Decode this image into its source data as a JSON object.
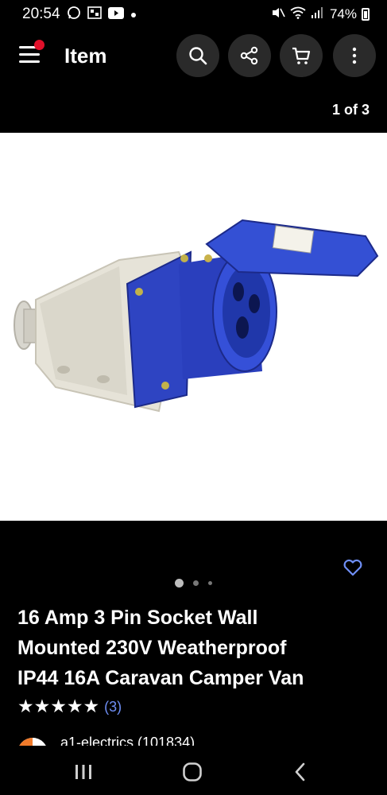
{
  "status_bar": {
    "time": "20:54",
    "battery": "74%"
  },
  "app_bar": {
    "title": "Item"
  },
  "gallery": {
    "counter": "1 of 3"
  },
  "product": {
    "title_lines": [
      "16 Amp 3 Pin Socket Wall",
      "Mounted 230V Weatherproof",
      "IP44 16A Caravan Camper Van"
    ],
    "stars": "★★★★★",
    "rating_stars": 5,
    "review_count": "(3)"
  },
  "seller": {
    "name": "a1-electrics (101834)"
  },
  "colors": {
    "accent_link": "#6f8ff6",
    "notification_dot": "#e0102a",
    "socket_blue": "#2f47c8"
  },
  "icons": {
    "menu": "hamburger-icon",
    "search": "search-icon",
    "share": "share-icon",
    "cart": "cart-icon",
    "more": "more-vertical-icon",
    "favorite": "heart-icon"
  }
}
